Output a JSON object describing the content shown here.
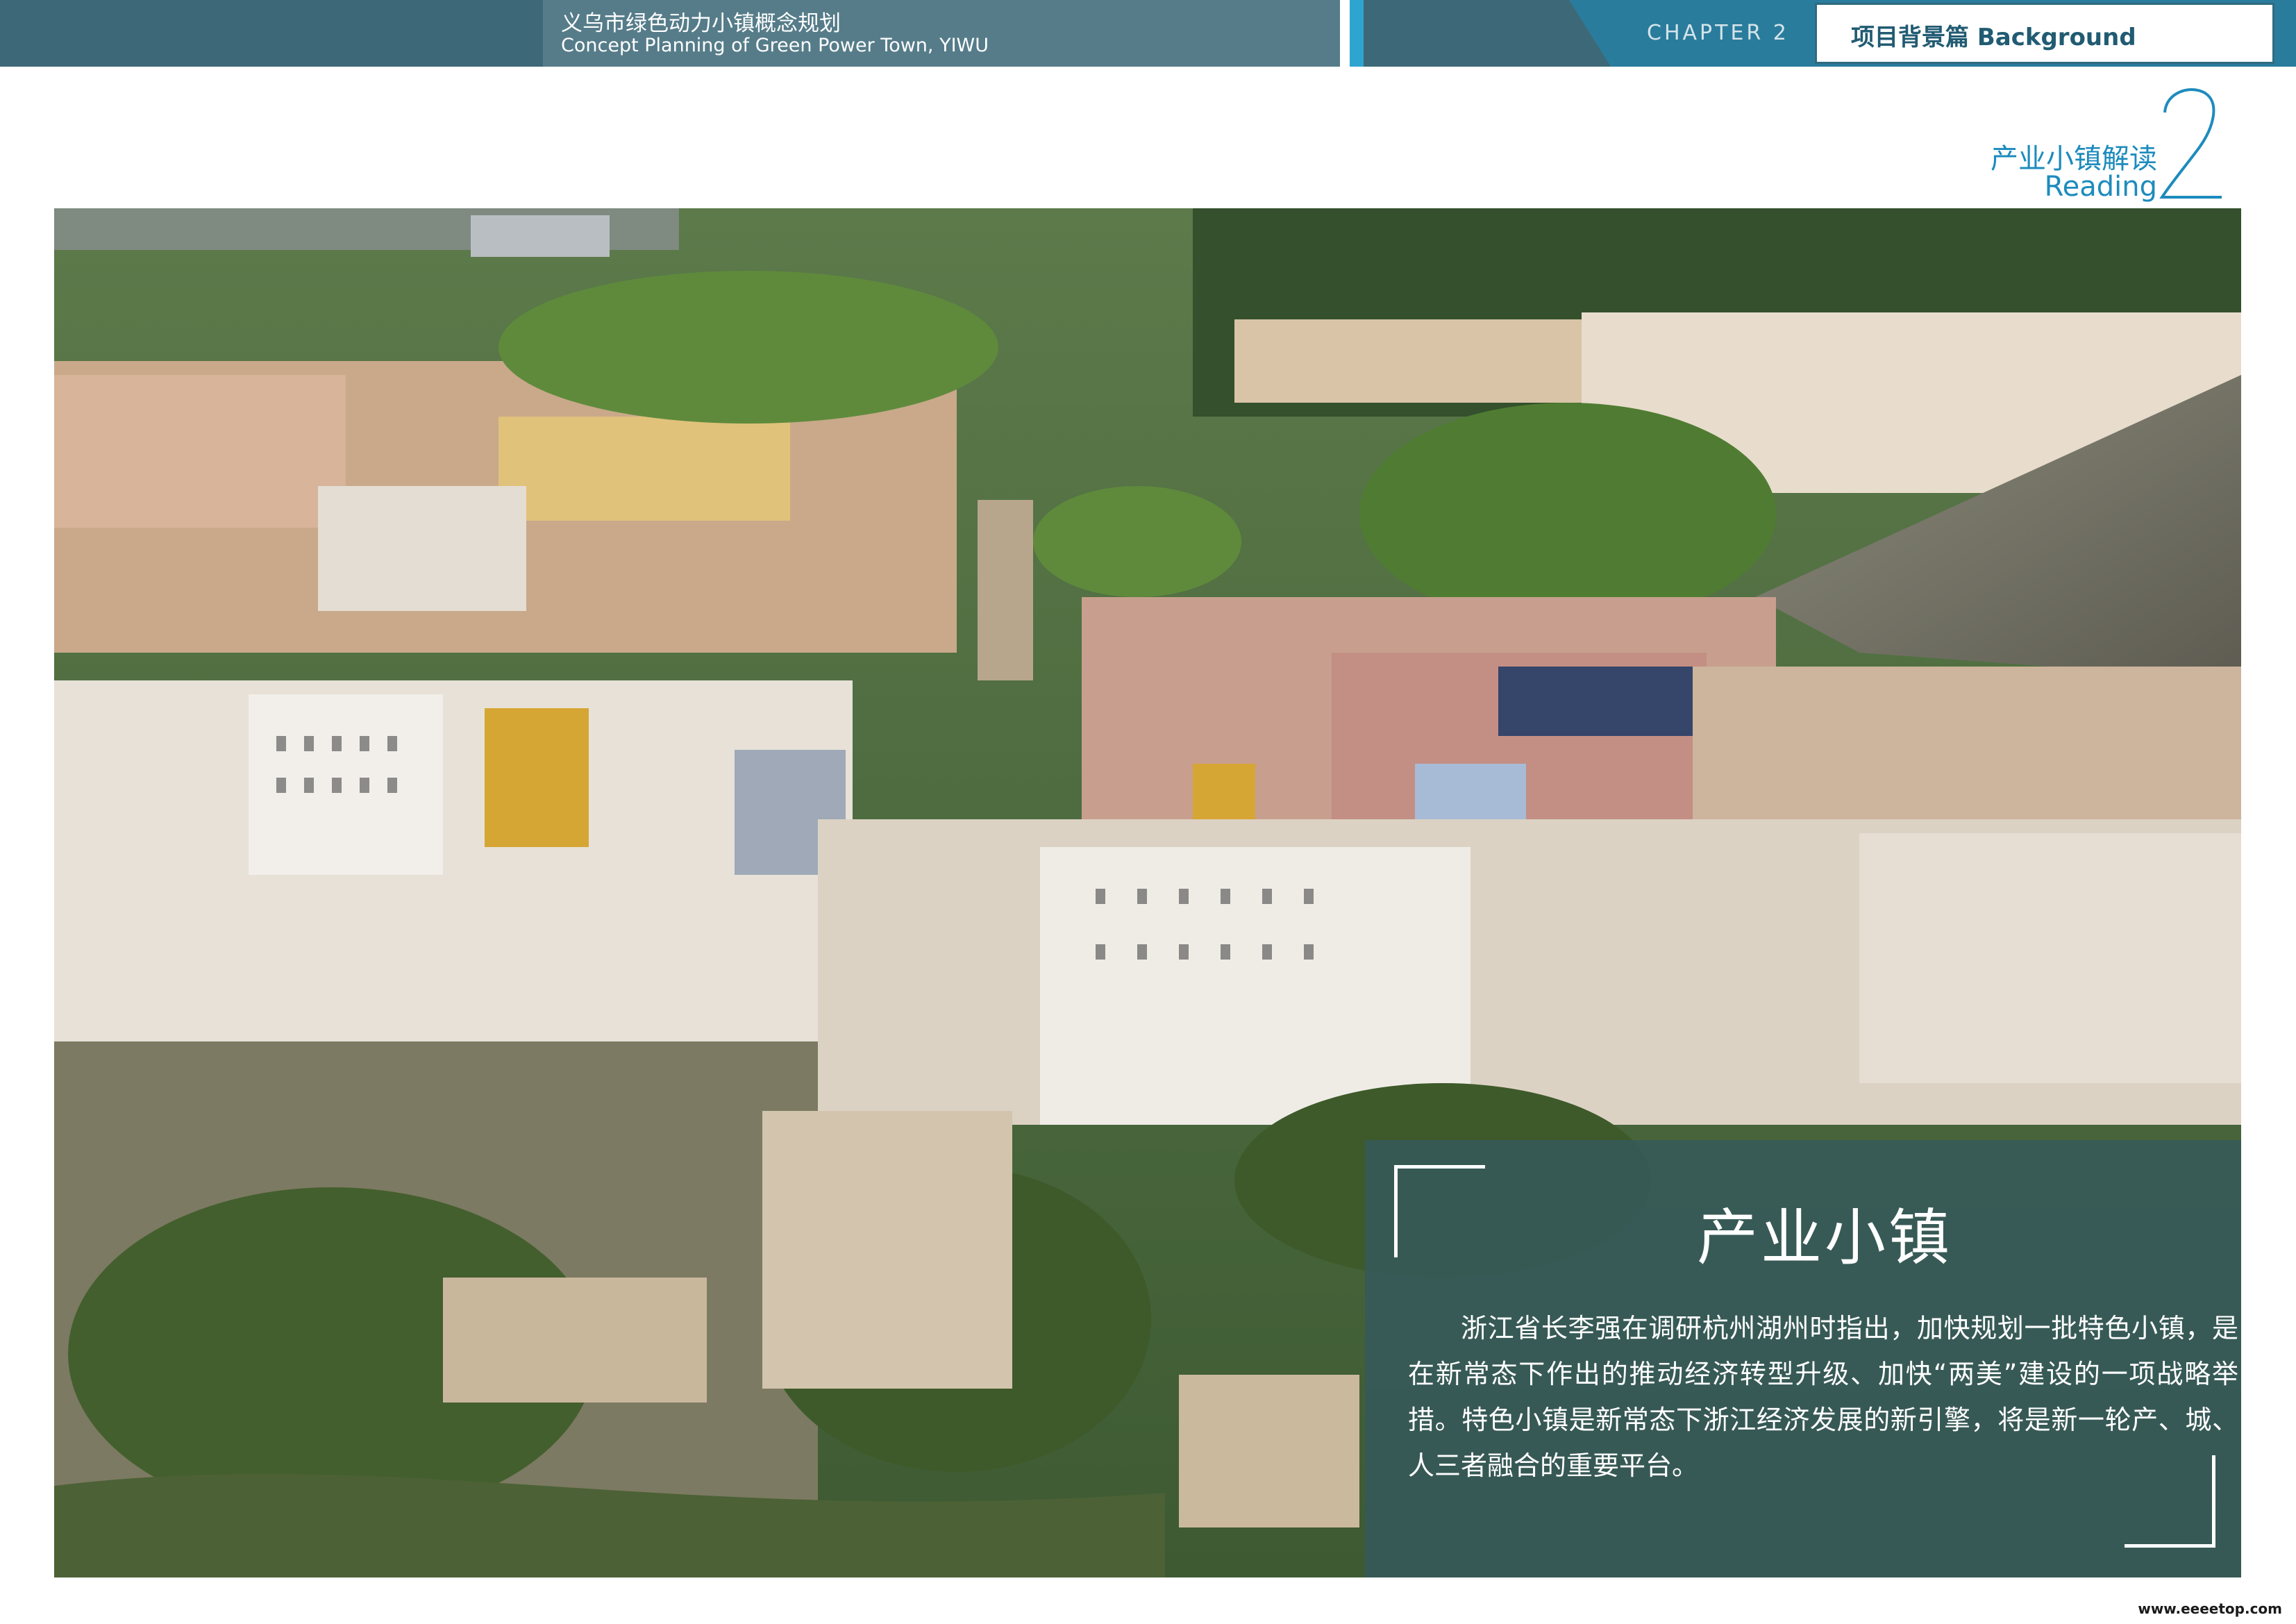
{
  "header": {
    "title_zh": "义乌市绿色动力小镇概念规划",
    "title_en": "Concept Planning of Green Power Town, YIWU",
    "chapter": "CHAPTER 2",
    "section": "项目背景篇 Background"
  },
  "subheading": {
    "zh": "产业小镇解读",
    "en": "Reading",
    "number": "2"
  },
  "photo": {
    "subject_icon": "hillside-town-photo"
  },
  "panel": {
    "title": "产业小镇",
    "body": "浙江省长李强在调研杭州湖州时指出，加快规划一批特色小镇，是在新常态下作出的推动经济转型升级、加快“两美”建设的一项战略举措。特色小镇是新常态下浙江经济发展的新引擎，将是新一轮产、城、人三者融合的重要平台。"
  },
  "watermark": "www.eeeetop.com",
  "colors": {
    "header_bg": "#3d6878",
    "accent_blue": "#2ea5d1",
    "heading_blue": "#1d8bbd",
    "panel_overlay": "#34585f"
  }
}
